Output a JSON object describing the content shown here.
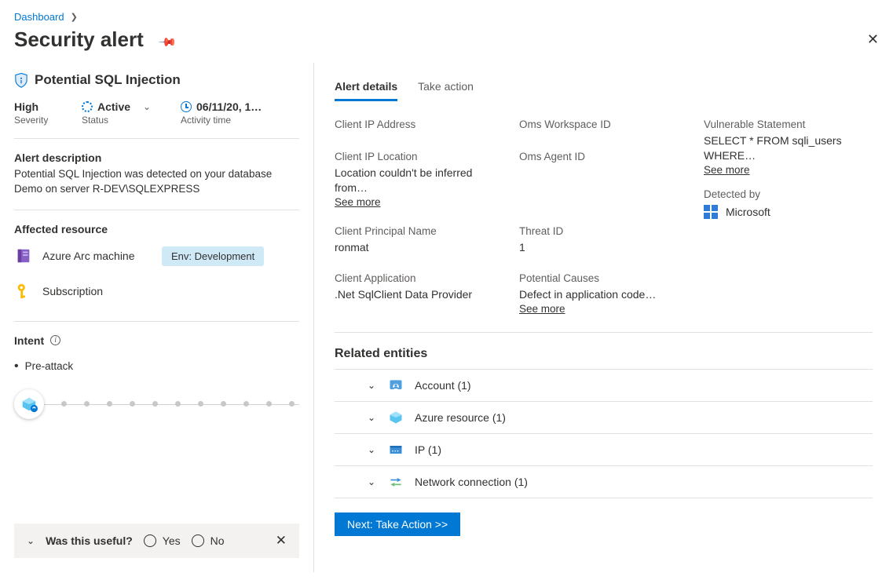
{
  "breadcrumb": {
    "parent": "Dashboard"
  },
  "page": {
    "title": "Security alert"
  },
  "alert": {
    "name": "Potential SQL Injection",
    "severity_label": "Severity",
    "severity_value": "High",
    "status_label": "Status",
    "status_value": "Active",
    "activity_label": "Activity time",
    "activity_value": "06/11/20, 1…",
    "description_label": "Alert description",
    "description": "Potential SQL Injection was detected on your database Demo on server R-DEV\\SQLEXPRESS",
    "affected_label": "Affected resource",
    "resources": [
      {
        "label": "Azure Arc machine",
        "tag": "Env: Development"
      },
      {
        "label": "Subscription",
        "tag": ""
      }
    ],
    "intent_label": "Intent",
    "intent_stage": "Pre-attack"
  },
  "useful": {
    "question": "Was this useful?",
    "yes": "Yes",
    "no": "No"
  },
  "tabs": {
    "details": "Alert details",
    "action": "Take action"
  },
  "details": {
    "client_ip_k": "Client IP Address",
    "client_ip_loc_k": "Client IP Location",
    "client_ip_loc_v": "Location couldn't be inferred from…",
    "client_principal_k": "Client Principal Name",
    "client_principal_v": "ronmat",
    "client_app_k": "Client Application",
    "client_app_v": ".Net SqlClient Data Provider",
    "oms_ws_k": "Oms Workspace ID",
    "oms_agent_k": "Oms Agent ID",
    "threat_id_k": "Threat ID",
    "threat_id_v": "1",
    "pot_causes_k": "Potential Causes",
    "pot_causes_v": "Defect in application code…",
    "vuln_stmt_k": "Vulnerable Statement",
    "vuln_stmt_v": "SELECT * FROM sqli_users WHERE…",
    "detected_by_k": "Detected by",
    "detected_by_v": "Microsoft",
    "see_more": "See more"
  },
  "related": {
    "label": "Related entities",
    "items": [
      {
        "label": "Account",
        "count": "(1)"
      },
      {
        "label": "Azure resource",
        "count": "(1)"
      },
      {
        "label": "IP",
        "count": "(1)"
      },
      {
        "label": "Network connection",
        "count": "(1)"
      }
    ]
  },
  "next_button": "Next: Take Action  >>"
}
